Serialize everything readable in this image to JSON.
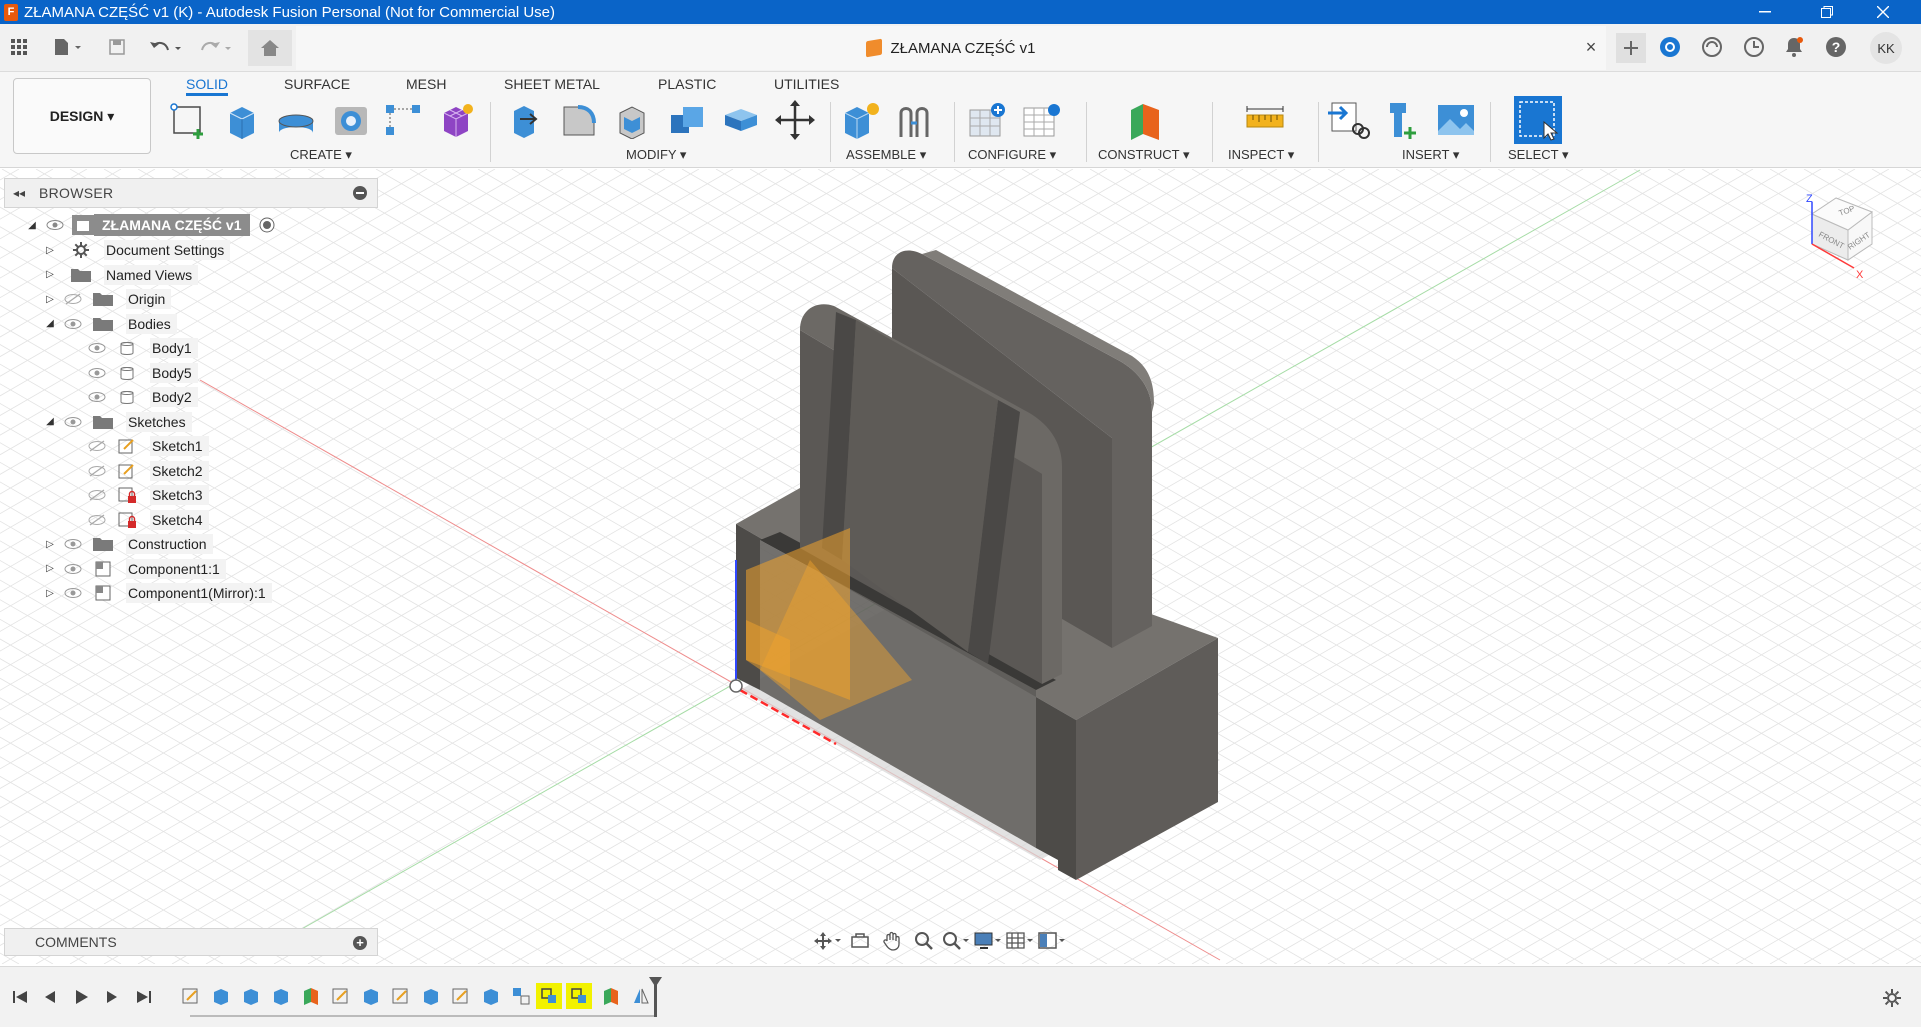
{
  "window": {
    "title": "ZŁAMANA CZĘŚĆ v1 (K) - Autodesk Fusion Personal (Not for Commercial Use)",
    "app_icon_letter": "F"
  },
  "document": {
    "tab_title": "ZŁAMANA CZĘŚĆ v1",
    "user_initials": "KK"
  },
  "ribbon": {
    "workspace": "DESIGN ▾",
    "tabs": [
      "SOLID",
      "SURFACE",
      "MESH",
      "SHEET METAL",
      "PLASTIC",
      "UTILITIES"
    ],
    "active_tab": "SOLID",
    "groups": [
      "CREATE ▾",
      "MODIFY ▾",
      "ASSEMBLE ▾",
      "CONFIGURE ▾",
      "CONSTRUCT ▾",
      "INSPECT ▾",
      "INSERT ▾",
      "SELECT ▾"
    ]
  },
  "browser": {
    "title": "BROWSER",
    "root": "ZŁAMANA CZĘŚĆ v1",
    "items": [
      {
        "label": "Document Settings",
        "icon": "gear-icon"
      },
      {
        "label": "Named Views",
        "icon": "folder-icon"
      },
      {
        "label": "Origin",
        "icon": "folder-icon",
        "visibility": "hidden"
      },
      {
        "label": "Bodies",
        "icon": "folder-icon",
        "expanded": true
      },
      {
        "label": "Body1",
        "icon": "body-icon"
      },
      {
        "label": "Body5",
        "icon": "body-icon"
      },
      {
        "label": "Body2",
        "icon": "body-icon"
      },
      {
        "label": "Sketches",
        "icon": "folder-icon",
        "expanded": true
      },
      {
        "label": "Sketch1",
        "icon": "sketch-icon",
        "visibility": "hidden"
      },
      {
        "label": "Sketch2",
        "icon": "sketch-icon",
        "visibility": "hidden"
      },
      {
        "label": "Sketch3",
        "icon": "sketch-locked-icon",
        "visibility": "hidden"
      },
      {
        "label": "Sketch4",
        "icon": "sketch-locked-icon",
        "visibility": "hidden"
      },
      {
        "label": "Construction",
        "icon": "folder-icon"
      },
      {
        "label": "Component1:1",
        "icon": "component-icon"
      },
      {
        "label": "Component1(Mirror):1",
        "icon": "component-icon"
      }
    ]
  },
  "comments": {
    "title": "COMMENTS"
  },
  "viewcube": {
    "top": "TOP",
    "front": "FRONT",
    "right": "RIGHT",
    "axis_z": "Z",
    "axis_x": "X"
  },
  "colors": {
    "titlebar": "#0a64c8",
    "accent": "#1976d2",
    "body": "#5a5855",
    "highlight": "#f2f200"
  }
}
